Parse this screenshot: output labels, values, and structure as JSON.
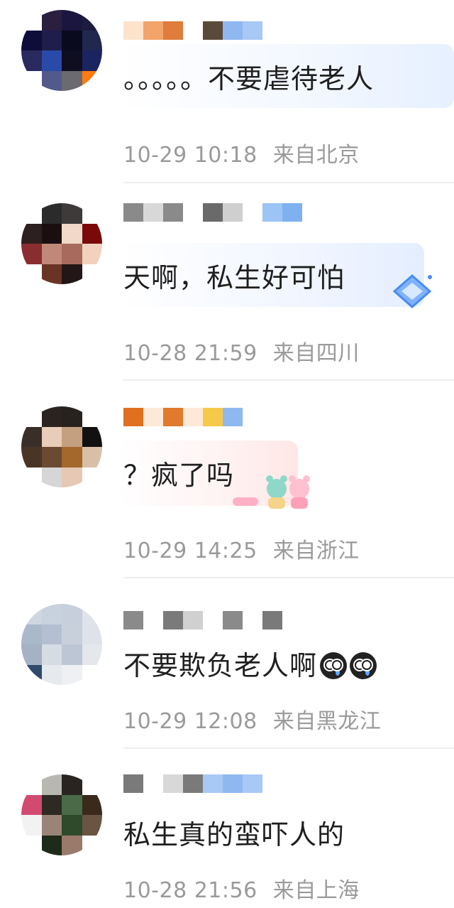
{
  "comments": [
    {
      "text": "。。。。。不要虐待老人",
      "date": "10-29 10:18",
      "location": "来自北京",
      "avatar_colors": [
        "#ffffff",
        "#2a1f3f",
        "#1a1640",
        "#1c1c40",
        "#0e0d3a",
        "#1f1d4a",
        "#0a0a1f",
        "#202850",
        "#2a2a5e",
        "#294aa8",
        "#0e0e20",
        "#1a2460",
        "#ffffff",
        "#525a8c",
        "#6a6a70",
        "#ff7b10"
      ],
      "name_colors": [
        "#fde3cc",
        "#f2a46a",
        "#e07d3c",
        "#ffffff",
        "#5a4a3a",
        "#8fb8f0",
        "#a8c8f5"
      ]
    },
    {
      "text": "天啊，私生好可怕",
      "date": "10-28 21:59",
      "location": "来自四川",
      "avatar_colors": [
        "#ffffff",
        "#2b2b2b",
        "#3e3a3a",
        "#ffffff",
        "#2d2020",
        "#1b0e0e",
        "#f1d8c8",
        "#7a0a0a",
        "#8a2d30",
        "#c08878",
        "#a86a5c",
        "#f2d2be",
        "#ffffff",
        "#6a3424",
        "#231616",
        "#ffffff"
      ],
      "name_colors": [
        "#8a8a8a",
        "#d8d8d8",
        "#8a8a8a",
        "#ffffff",
        "#6a6a6a",
        "#cfcfcf",
        "#ffffff",
        "#9cc4f5",
        "#7fb0ef"
      ]
    },
    {
      "text": "？疯了吗",
      "date": "10-29 14:25",
      "location": "来自浙江",
      "avatar_colors": [
        "#ffffff",
        "#2a2320",
        "#28221f",
        "#ffffff",
        "#3a2f28",
        "#e8cdb8",
        "#c4a080",
        "#111111",
        "#4a3426",
        "#6b4a34",
        "#a4682c",
        "#d8c0a8",
        "#ffffff",
        "#d6d6d6",
        "#e6c8b4",
        "#ffffff"
      ],
      "name_colors": [
        "#e0701f",
        "#fde9d8",
        "#e07a2c",
        "#fde9d8",
        "#f5c94a",
        "#8fb8f0"
      ]
    },
    {
      "text": "不要欺负老人啊",
      "date": "10-29 12:08",
      "location": "来自黑龙江",
      "avatar_colors": [
        "#cfd6e0",
        "#c8d2de",
        "#c6cfdb",
        "#e0e4ea",
        "#aab8cc",
        "#b4c0d2",
        "#c8d0dc",
        "#dfe3e9",
        "#a4b2c4",
        "#d6dce4",
        "#bcc6d4",
        "#e4e7ec",
        "#304a6a",
        "#e6e9ee",
        "#eef0f3",
        "#ffffff"
      ],
      "name_colors": [
        "#8a8a8a",
        "#ffffff",
        "#7a7a7a",
        "#d0d0d0",
        "#ffffff",
        "#8a8a8a",
        "#ffffff",
        "#7a7a7a"
      ]
    },
    {
      "text": "私生真的蛮吓人的",
      "date": "10-28 21:56",
      "location": "来自上海",
      "avatar_colors": [
        "#ffffff",
        "#b8b8b0",
        "#2a2420",
        "#ffffff",
        "#d24a70",
        "#2c2a22",
        "#4a6a48",
        "#3a2a1c",
        "#f2f2f2",
        "#9a8478",
        "#2e4a2a",
        "#6a5442",
        "#ffffff",
        "#1e2a1a",
        "#9a7a6a",
        "#ffffff"
      ],
      "name_colors": [
        "#7a7a7a",
        "#ffffff",
        "#d8d8d8",
        "#7a7a7a",
        "#a8c8f5",
        "#8fb8f0",
        "#a8c8f5"
      ]
    }
  ]
}
